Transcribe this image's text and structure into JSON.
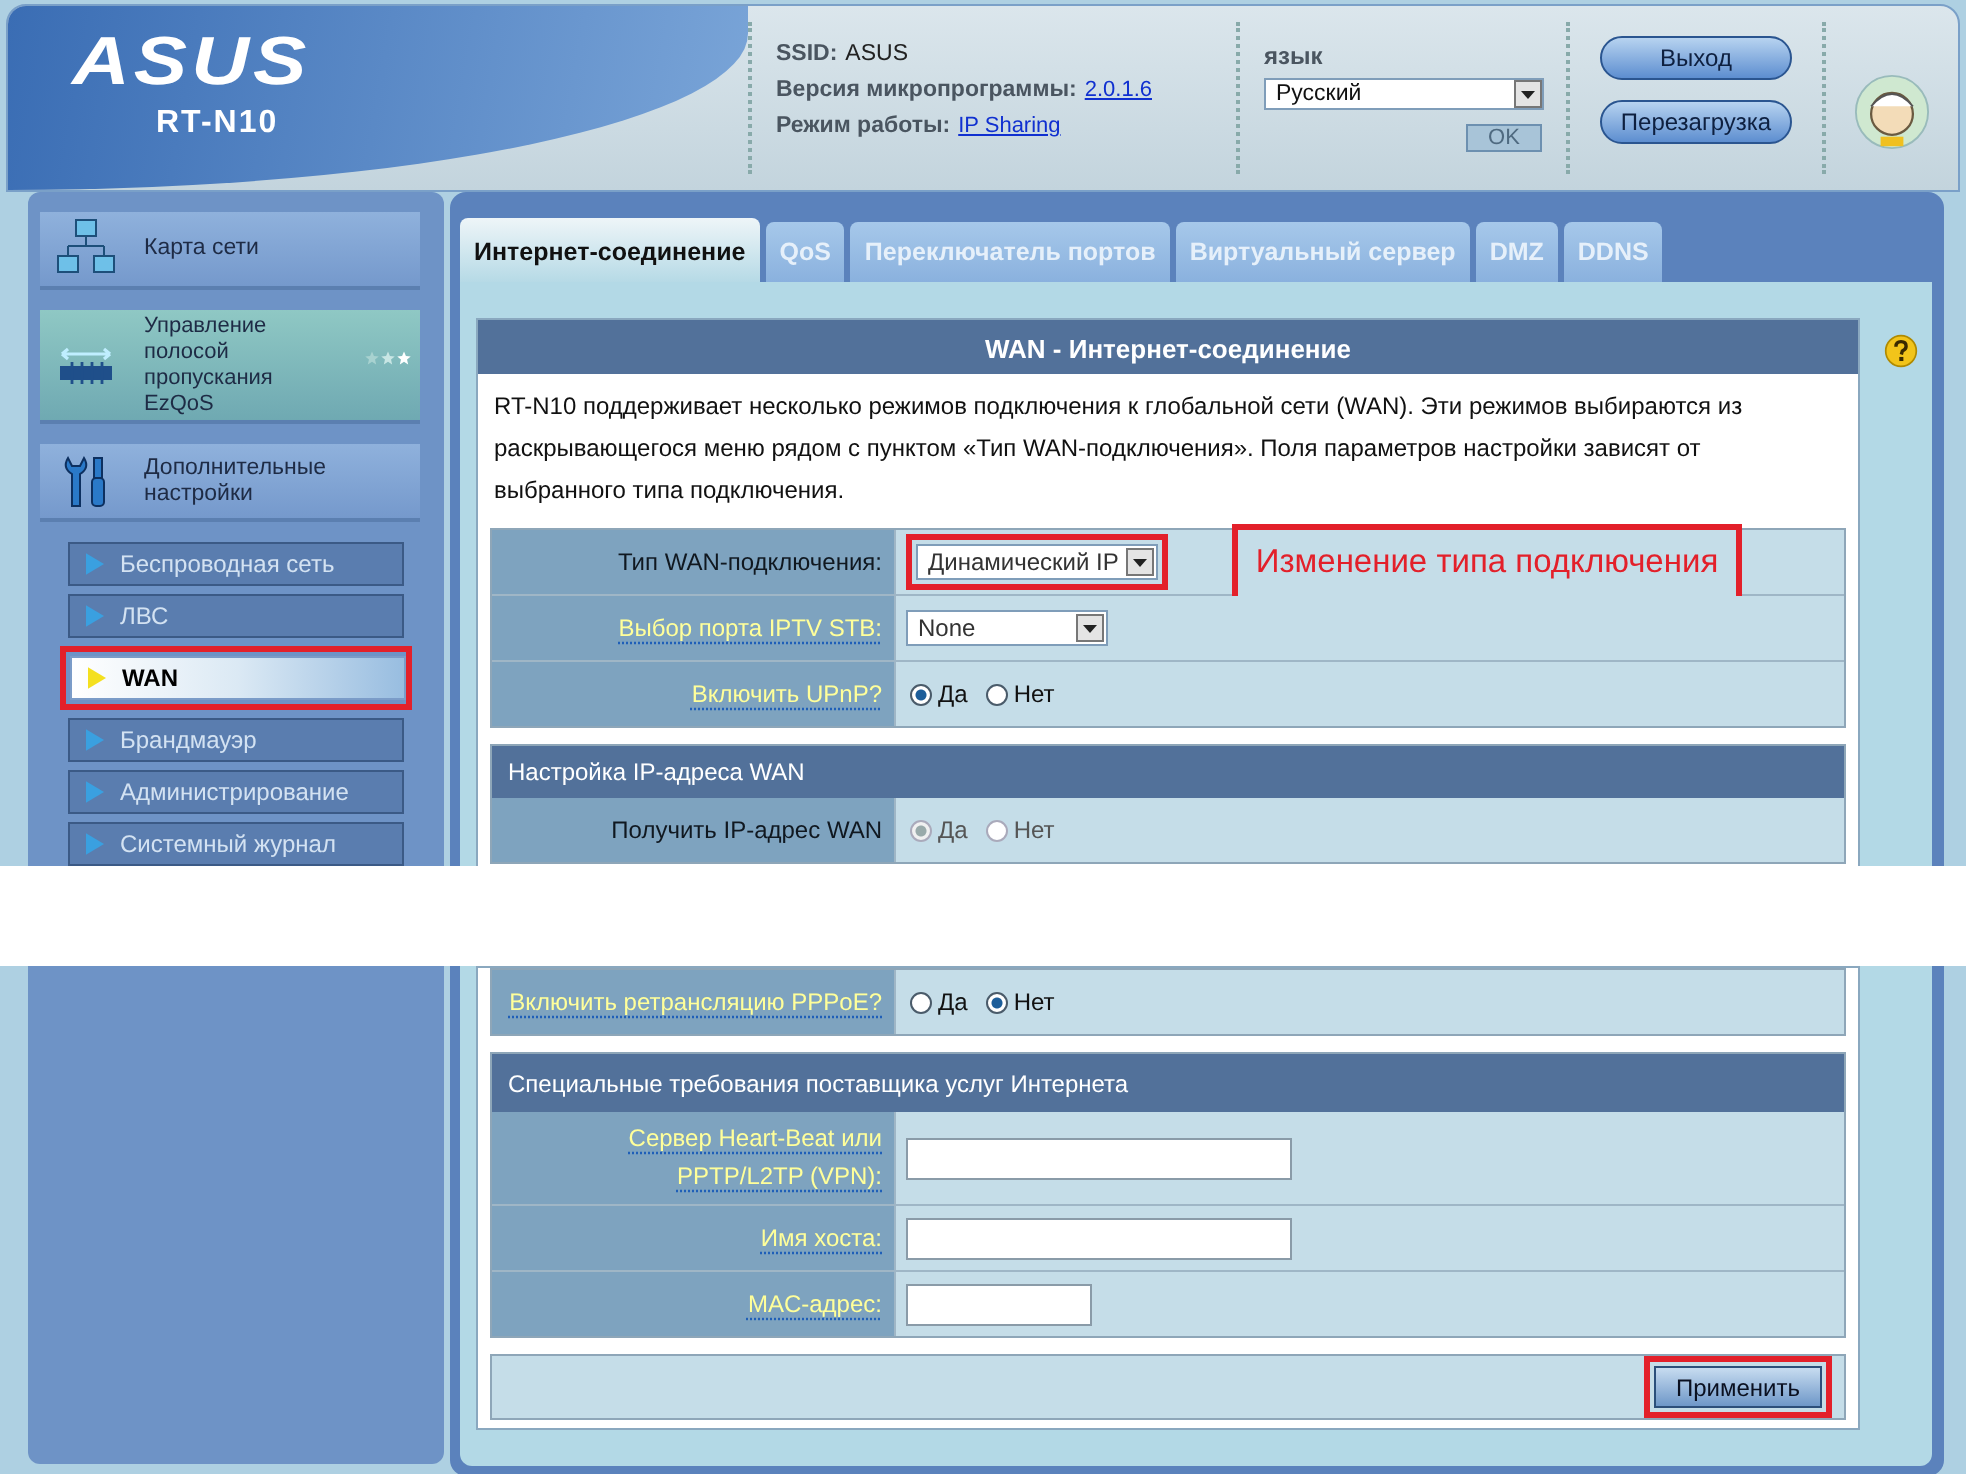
{
  "header": {
    "logo": "ASUS",
    "model": "RT-N10",
    "info": [
      {
        "label": "SSID:",
        "value": "ASUS",
        "link": false
      },
      {
        "label": "Версия микропрограммы:",
        "value": "2.0.1.6",
        "link": true
      },
      {
        "label": "Режим работы:",
        "value": "IP Sharing",
        "link": true
      }
    ],
    "language": {
      "label": "язык",
      "value": "Русский",
      "ok_button": {
        "label": "OK",
        "disabled": true
      }
    },
    "buttons": [
      "Выход",
      "Перезагрузка"
    ]
  },
  "sidebar": {
    "main_items": [
      {
        "kind": "map",
        "label": "Карта сети"
      },
      {
        "kind": "qos",
        "label": "Управление полосой пропускания EzQoS"
      },
      {
        "kind": "advanced",
        "label": "Дополнительные настройки"
      }
    ],
    "sub_items": [
      {
        "label": "Беспроводная сеть",
        "selected": false,
        "highlighted": false
      },
      {
        "label": "ЛВС",
        "selected": false,
        "highlighted": false
      },
      {
        "label": "WAN",
        "selected": true,
        "highlighted": true
      },
      {
        "label": "Брандмауэр",
        "selected": false,
        "highlighted": false
      },
      {
        "label": "Администрирование",
        "selected": false,
        "highlighted": false
      },
      {
        "label": "Системный журнал",
        "selected": false,
        "highlighted": false
      }
    ]
  },
  "tabs": [
    {
      "label": "Интернет-соединение",
      "selected": true
    },
    {
      "label": "QoS",
      "selected": false
    },
    {
      "label": "Переключатель портов",
      "selected": false
    },
    {
      "label": "Виртуальный сервер",
      "selected": false
    },
    {
      "label": "DMZ",
      "selected": false
    },
    {
      "label": "DDNS",
      "selected": false
    }
  ],
  "panel": {
    "title": "WAN - Интернет-соединение",
    "description": "RT-N10 поддерживает несколько режимов подключения к глобальной сети (WAN). Эти режимов выбираются из раскрывающегося меню рядом с пунктом «Тип WAN-подключения». Поля параметров настройки зависят от выбранного типа подключения.",
    "upper_sections": [
      {
        "rows": [
          {
            "kind": "select",
            "label": "Тип WAN-подключения:",
            "link": false,
            "value": "Динамический IP",
            "highlighted": true,
            "annotation": "Изменение типа подключения"
          },
          {
            "kind": "select",
            "label": "Выбор порта IPTV STB:",
            "link": true,
            "value": "None",
            "highlighted": false
          },
          {
            "kind": "radio",
            "label": "Включить UPnP?",
            "link": true,
            "disabled": false,
            "options": [
              {
                "label": "Да",
                "selected": true
              },
              {
                "label": "Нет",
                "selected": false
              }
            ]
          }
        ]
      },
      {
        "header": "Настройка IP-адреса WAN",
        "rows": [
          {
            "kind": "radio",
            "label": "Получить IP-адрес WAN",
            "link": false,
            "disabled": true,
            "options": [
              {
                "label": "Да",
                "selected": true
              },
              {
                "label": "Нет",
                "selected": false
              }
            ]
          }
        ]
      }
    ],
    "lower_sections": [
      {
        "rows": [
          {
            "kind": "radio",
            "label": "Включить ретрансляцию PPPoE?",
            "link": true,
            "disabled": false,
            "options": [
              {
                "label": "Да",
                "selected": false
              },
              {
                "label": "Нет",
                "selected": true
              }
            ]
          }
        ]
      },
      {
        "header": "Специальные требования поставщика услуг Интернета",
        "rows": [
          {
            "kind": "text",
            "label": "Сервер Heart-Beat или PPTP/L2TP (VPN):",
            "link": true
          },
          {
            "kind": "text",
            "label": "Имя хоста:",
            "link": true
          },
          {
            "kind": "short_text",
            "label": "MAC-адрес:",
            "link": true
          }
        ]
      }
    ],
    "apply_button": {
      "label": "Применить",
      "highlighted": true
    }
  }
}
